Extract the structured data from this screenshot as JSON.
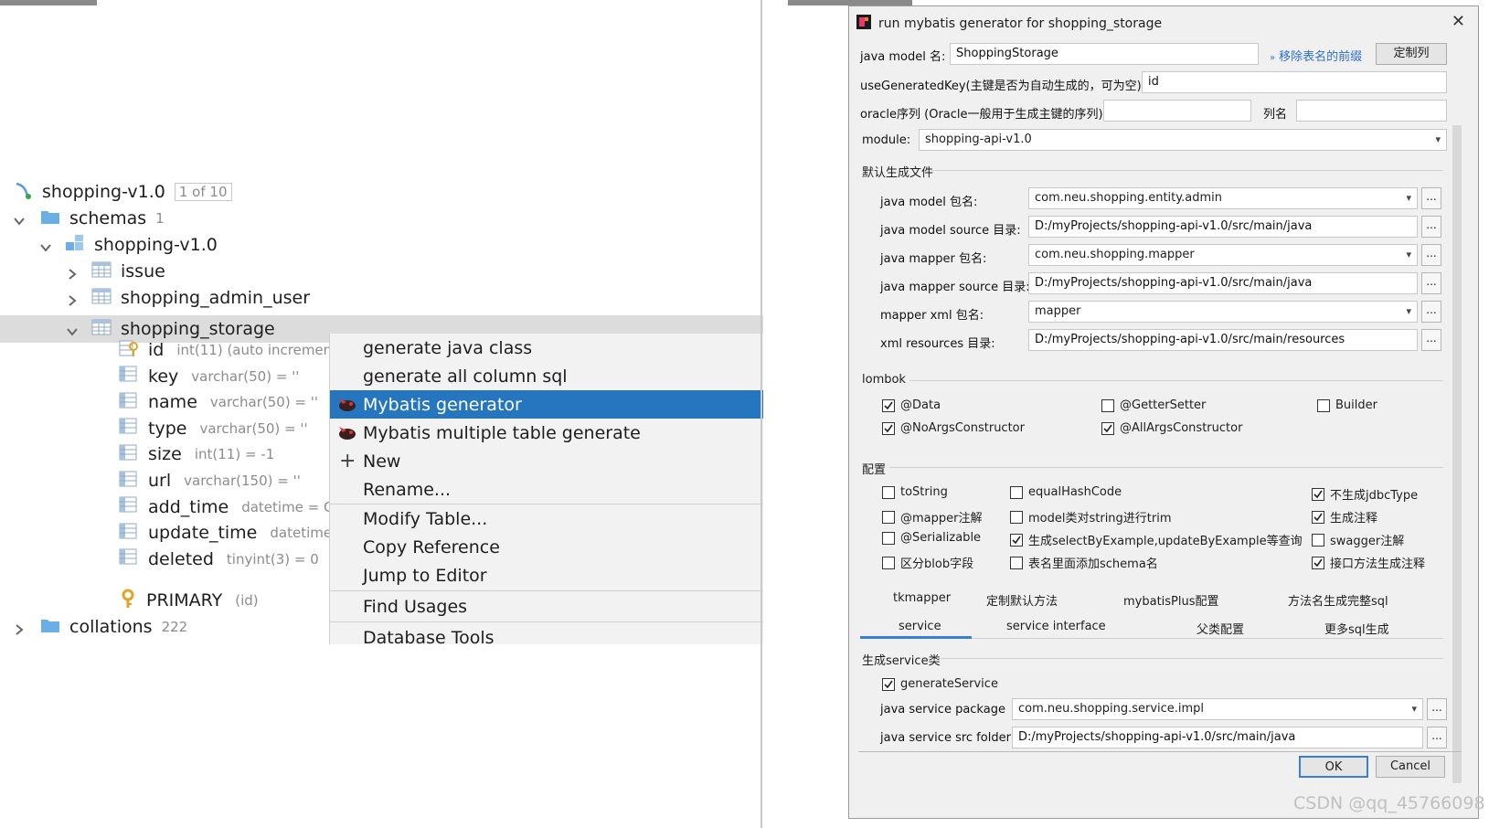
{
  "tree": {
    "datasource": {
      "label": "shopping-v1.0",
      "badge": "1 of 10"
    },
    "schemas": {
      "label": "schemas",
      "count": "1"
    },
    "schema": {
      "label": "shopping-v1.0"
    },
    "tables": [
      "issue",
      "shopping_admin_user",
      "shopping_storage"
    ],
    "columns": [
      {
        "name": "id",
        "type": "int(11) (auto incremen"
      },
      {
        "name": "key",
        "type": "varchar(50) = ''"
      },
      {
        "name": "name",
        "type": "varchar(50) = ''"
      },
      {
        "name": "type",
        "type": "varchar(50) = ''"
      },
      {
        "name": "size",
        "type": "int(11) = -1"
      },
      {
        "name": "url",
        "type": "varchar(150) = ''"
      },
      {
        "name": "add_time",
        "type": "datetime = CU"
      },
      {
        "name": "update_time",
        "type": "datetime"
      },
      {
        "name": "deleted",
        "type": "tinyint(3) = 0"
      }
    ],
    "primary": {
      "name": "PRIMARY",
      "type": "(id)"
    },
    "collations": {
      "label": "collations",
      "count": "222"
    }
  },
  "menu": {
    "items": [
      "generate java class",
      "generate all column sql",
      "Mybatis generator",
      "Mybatis multiple table generate",
      "New",
      "Rename...",
      "Modify Table...",
      "Copy Reference",
      "Jump to Editor",
      "Find Usages",
      "Database Tools"
    ],
    "selected": "Mybatis generator"
  },
  "dialog": {
    "title": "run mybatis generator for shopping_storage",
    "java_model_label": "java model 名:",
    "java_model_value": "ShoppingStorage",
    "remove_prefix_link": "移除表名的前缀",
    "customize_columns_btn": "定制列",
    "use_generated_key_label": "useGeneratedKey(主键是否为自动生成的，可为空):",
    "use_generated_key_value": "id",
    "oracle_label": "oracle序列 (Oracle一般用于生成主键的序列)",
    "column_name_label": "列名",
    "module_label": "module:",
    "module_value": "shopping-api-v1.0",
    "default_files_section": "默认生成文件",
    "paths": [
      {
        "label": "java model 包名:",
        "value": "com.neu.shopping.entity.admin",
        "combo": true
      },
      {
        "label": "java model source 目录:",
        "value": "D:/myProjects/shopping-api-v1.0/src/main/java",
        "combo": false
      },
      {
        "label": "java mapper 包名:",
        "value": "com.neu.shopping.mapper",
        "combo": true
      },
      {
        "label": "java mapper source 目录:",
        "value": "D:/myProjects/shopping-api-v1.0/src/main/java",
        "combo": false
      },
      {
        "label": "mapper xml 包名:",
        "value": "mapper",
        "combo": true
      },
      {
        "label": "xml resources 目录:",
        "value": "D:/myProjects/shopping-api-v1.0/src/main/resources",
        "combo": false
      }
    ],
    "lombok_section": "lombok",
    "lombok": [
      {
        "label": "@Data",
        "checked": true
      },
      {
        "label": "@GetterSetter",
        "checked": false
      },
      {
        "label": "Builder",
        "checked": false
      },
      {
        "label": "@NoArgsConstructor",
        "checked": true
      },
      {
        "label": "@AllArgsConstructor",
        "checked": true
      }
    ],
    "config_section": "配置",
    "config": [
      {
        "label": "toString",
        "checked": false
      },
      {
        "label": "equalHashCode",
        "checked": false
      },
      {
        "label": "不生成jdbcType",
        "checked": true
      },
      {
        "label": "@mapper注解",
        "checked": false
      },
      {
        "label": "model类对string进行trim",
        "checked": false
      },
      {
        "label": "生成注释",
        "checked": true
      },
      {
        "label": "@Serializable",
        "checked": false
      },
      {
        "label": "生成selectByExample,updateByExample等查询",
        "checked": true
      },
      {
        "label": "swagger注解",
        "checked": false
      },
      {
        "label": "区分blob字段",
        "checked": false
      },
      {
        "label": "表名里面添加schema名",
        "checked": false
      },
      {
        "label": "接口方法生成注释",
        "checked": true
      }
    ],
    "tabs_row1": [
      "tkmapper",
      "定制默认方法",
      "mybatisPlus配置",
      "方法名生成完整sql"
    ],
    "tabs_row2": [
      "service",
      "service interface",
      "父类配置",
      "更多sql生成"
    ],
    "active_tab": "service",
    "service_section": "生成service类",
    "generate_service": {
      "label": "generateService",
      "checked": true
    },
    "service_package_label": "java service package",
    "service_package_value": "com.neu.shopping.service.impl",
    "service_folder_label": "java service src folder",
    "service_folder_value": "D:/myProjects/shopping-api-v1.0/src/main/java",
    "ok": "OK",
    "cancel": "Cancel",
    "browse": "..."
  },
  "watermark": "CSDN @qq_45766098",
  "colors": {
    "selection": "#2675bf",
    "tab_underline": "#3b7ed6",
    "link": "#2d6fd0"
  }
}
